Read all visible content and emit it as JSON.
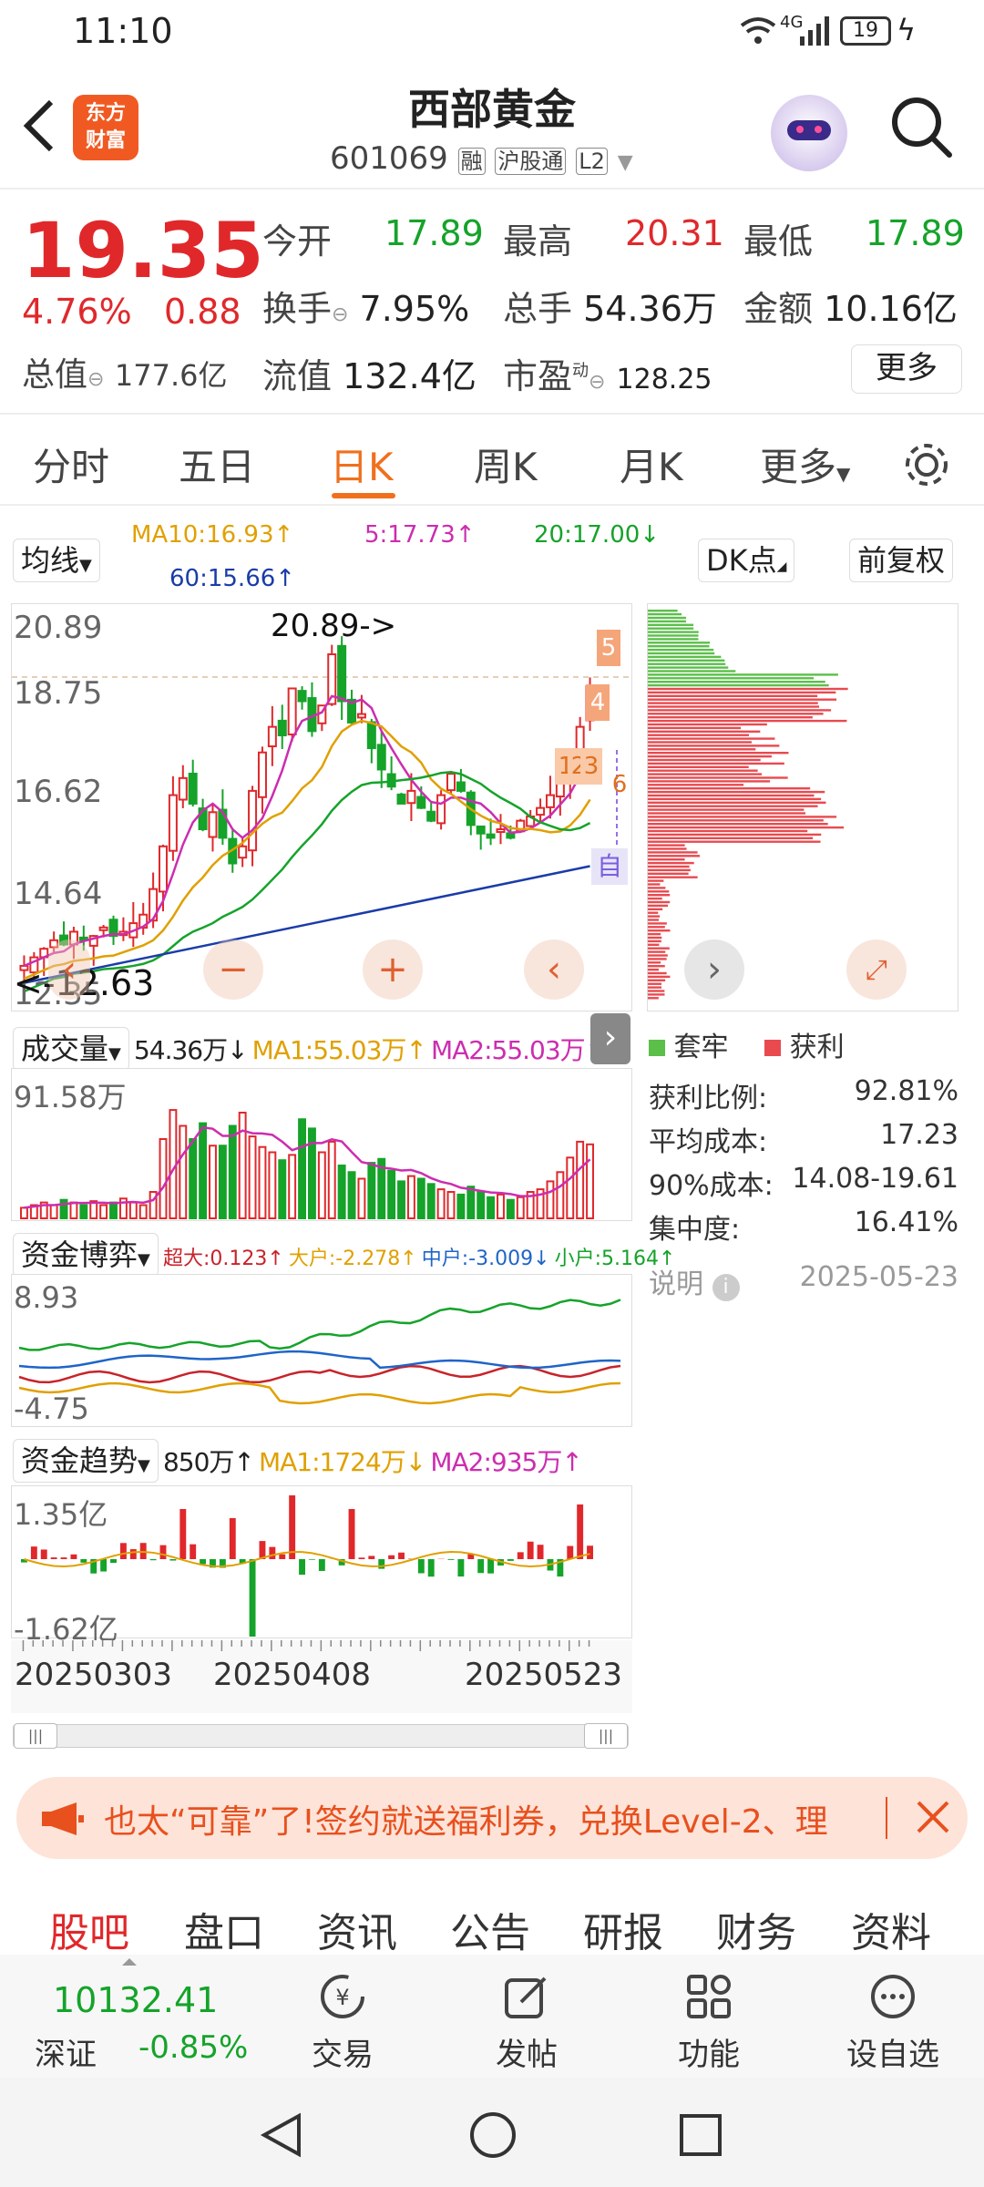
{
  "status": {
    "time": "11:10",
    "network": "4G",
    "battery": "19"
  },
  "header": {
    "title": "西部黄金",
    "code": "601069",
    "tags": [
      "融",
      "沪股通",
      "L2"
    ],
    "logo_line1": "东方",
    "logo_line2": "财富"
  },
  "quote": {
    "price": "19.35",
    "change_pct": "4.76%",
    "change": "0.88",
    "open_label": "今开",
    "open": "17.89",
    "high_label": "最高",
    "high": "20.31",
    "low_label": "最低",
    "low": "17.89",
    "turnover_label": "换手",
    "turnover": "7.95%",
    "volume_label": "总手",
    "volume": "54.36万",
    "amount_label": "金额",
    "amount": "10.16亿",
    "mktcap_label": "总值",
    "mktcap": "177.6亿",
    "float_label": "流值",
    "float": "132.4亿",
    "pe_label": "市盈",
    "pe_sup": "动",
    "pe": "128.25",
    "more": "更多"
  },
  "tabs": [
    "分时",
    "五日",
    "日K",
    "周K",
    "月K",
    "更多"
  ],
  "active_tab": 2,
  "kline": {
    "ma_btn": "均线",
    "ma5": "5:17.73↑",
    "ma10": "MA10:16.93↑",
    "ma20": "20:17.00↓",
    "ma60": "60:15.66↑",
    "dk_btn": "DK点",
    "fq_btn": "前复权",
    "ymax": "20.89",
    "y2": "18.75",
    "y3": "16.62",
    "y4": "14.64",
    "ymin": "12.35",
    "high_note": "20.89->",
    "low_note": "<-12.63",
    "badges": [
      "5",
      "4",
      "1",
      "2",
      "3",
      "6",
      "自"
    ]
  },
  "chip": {
    "legend_trap": "套牢",
    "legend_profit": "获利",
    "rows": [
      {
        "label": "获利比例:",
        "value": "92.81%"
      },
      {
        "label": "平均成本:",
        "value": "17.23"
      },
      {
        "label": "90%成本:",
        "value": "14.08-19.61"
      },
      {
        "label": "集中度:",
        "value": "16.41%"
      }
    ],
    "note": "说明",
    "date": "2025-05-23"
  },
  "volume": {
    "btn": "成交量",
    "val": "54.36万↓",
    "ma1": "MA1:55.03万↑",
    "ma2": "MA2:55.03万↑",
    "ymax": "91.58万"
  },
  "fund_game": {
    "btn": "资金博弈",
    "super": "超大:0.123↑",
    "big": "大户:-2.278↑",
    "mid": "中户:-3.009↓",
    "small": "小户:5.164↑",
    "ymax": "8.93",
    "ymin": "-4.75"
  },
  "fund_trend": {
    "btn": "资金趋势",
    "val": "850万↑",
    "ma1": "MA1:1724万↓",
    "ma2": "MA2:935万↑",
    "ymax": "1.35亿",
    "ymin": "-1.62亿"
  },
  "dates": [
    "20250303",
    "20250408",
    "20250523"
  ],
  "banner": {
    "text": "也太“可靠”了!签约就送福利券，兑换Level-2、理"
  },
  "bottom_tabs": [
    "股吧",
    "盘口",
    "资讯",
    "公告",
    "研报",
    "财务",
    "资料"
  ],
  "dock": {
    "index_value": "10132.41",
    "index_name": "深证",
    "index_change": "-0.85%",
    "items": [
      "交易",
      "发帖",
      "功能",
      "设自选"
    ]
  },
  "colors": {
    "up": "#e0282b",
    "down": "#15a32a",
    "accent": "#f0701e"
  }
}
